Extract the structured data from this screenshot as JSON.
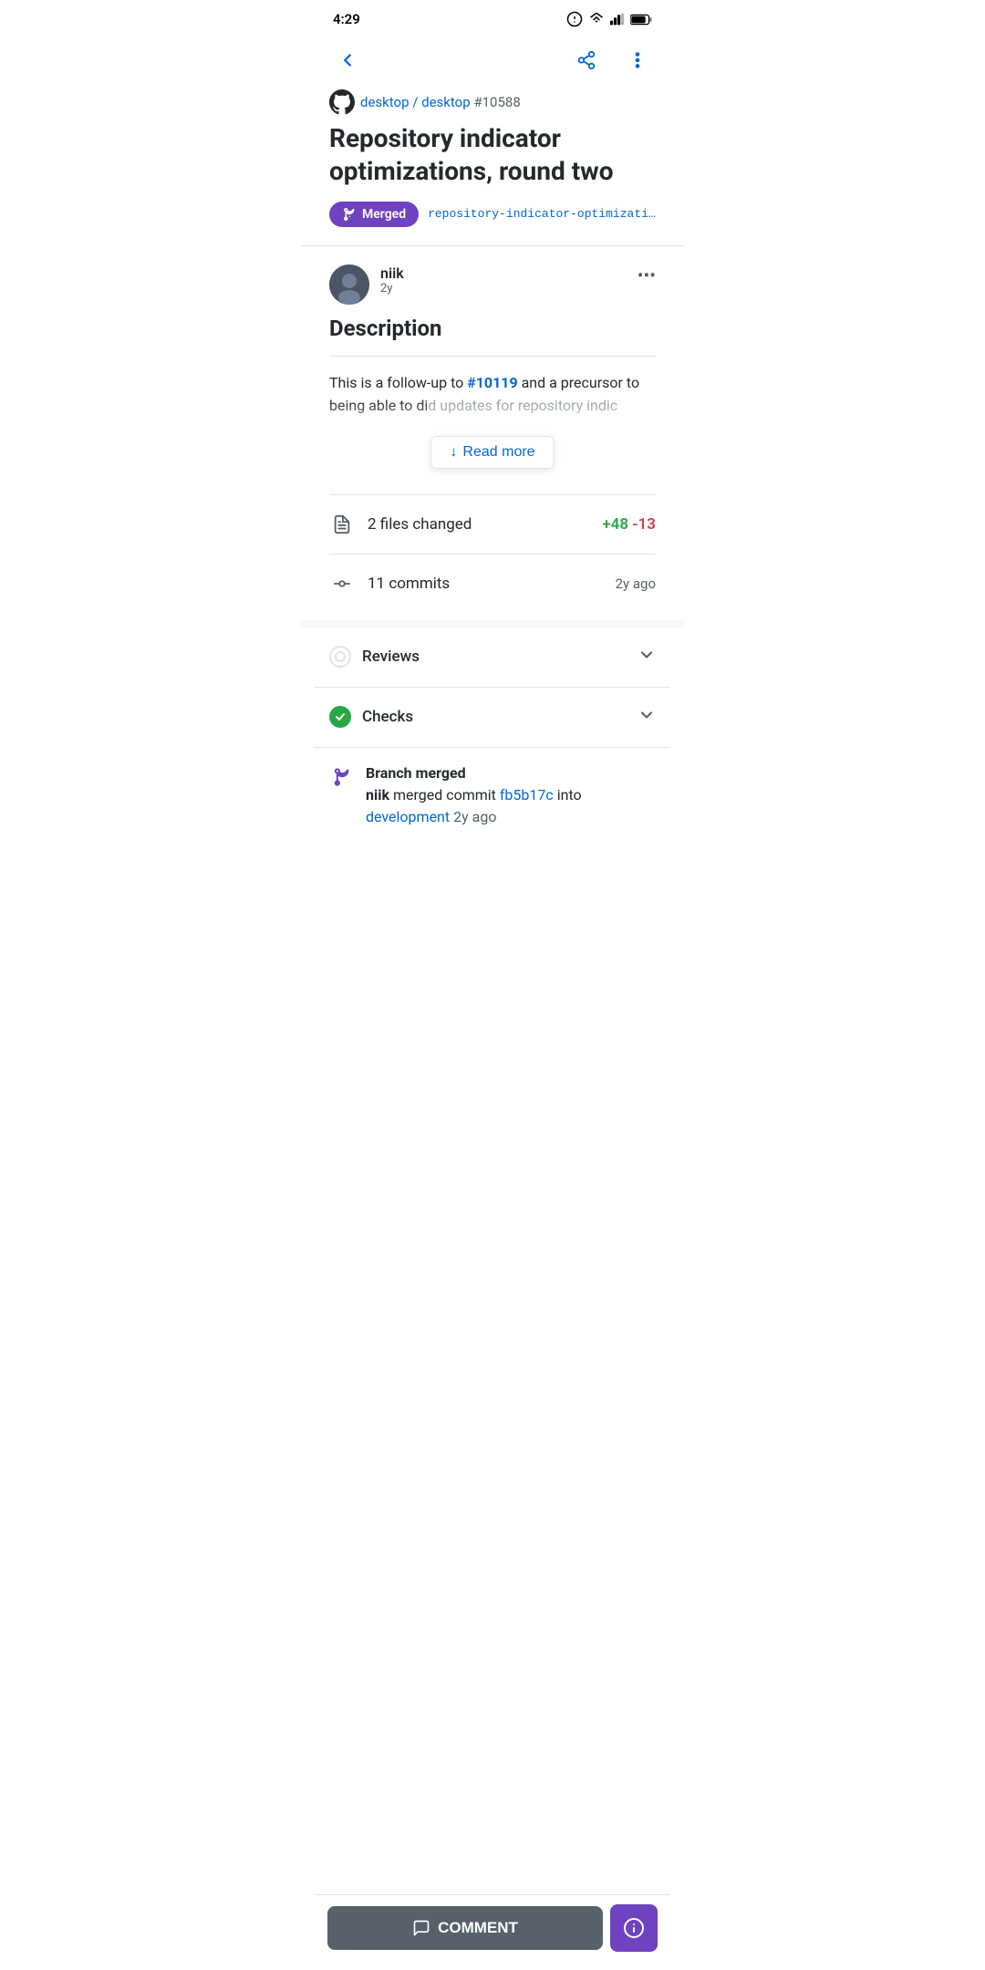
{
  "statusBar": {
    "time": "4:29"
  },
  "header": {
    "backLabel": "Back",
    "shareLabel": "Share",
    "moreLabel": "More options"
  },
  "breadcrumb": {
    "repo": "desktop / desktop",
    "issue": "#10588"
  },
  "pr": {
    "title": "Repository indicator optimizations, round two",
    "status": "Merged",
    "branchName": "repository-indicator-optimizatio..."
  },
  "comment": {
    "author": "niik",
    "timeAgo": "2y",
    "descriptionTitle": "Description",
    "bodyPrefix": "This is a follow-up to ",
    "bodyIssueRef": "#10119",
    "bodyMid": " and a precursor to being able to di",
    "bodyFaded1": "d updates for repository indic",
    "readMoreLabel": "Read more"
  },
  "stats": {
    "filesChanged": "2 files changed",
    "additions": "+48",
    "deletions": "-13",
    "commits": "11 commits",
    "commitsTime": "2y ago"
  },
  "sections": {
    "reviews": {
      "label": "Reviews",
      "status": "pending"
    },
    "checks": {
      "label": "Checks",
      "status": "success"
    }
  },
  "mergeInfo": {
    "label": "Branch merged",
    "author": "niik",
    "actionText": "merged commit",
    "commitHash": "fb5b17c",
    "into": "into",
    "branch": "development",
    "timeAgo": "2y ago"
  },
  "bottomBar": {
    "commentLabel": "COMMENT",
    "infoLabel": "ℹ"
  }
}
